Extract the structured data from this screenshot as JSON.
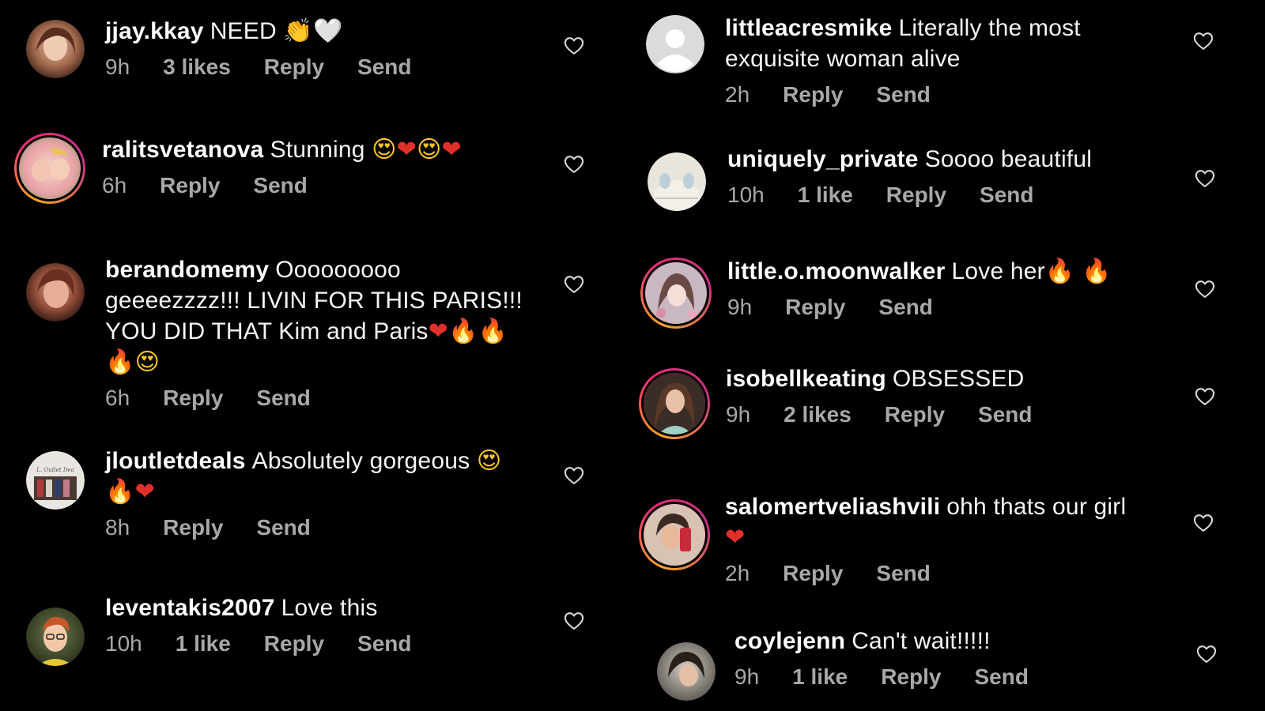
{
  "colors": {
    "background": "#000000",
    "text": "#ffffff",
    "meta": "#a8a8a8",
    "story_ring_start": "#f9a825",
    "story_ring_end": "#c13584"
  },
  "icons": {
    "like": "heart-outline-icon",
    "default_avatar": "default-avatar-icon"
  },
  "left_column": [
    {
      "username": "jjay.kkay",
      "text": "NEED",
      "emoji": [
        "👏",
        "🤍"
      ],
      "time": "9h",
      "likes": "3 likes",
      "reply": "Reply",
      "send": "Send"
    },
    {
      "username": "ralitsvetanova",
      "text": "Stunning",
      "emoji": [
        "😍",
        "❤",
        "😍",
        "❤"
      ],
      "time": "6h",
      "likes": "",
      "reply": "Reply",
      "send": "Send"
    },
    {
      "username": "berandomemy",
      "text_line1": "Ooooooooo",
      "text_line2": "geeeezzzz!!! LIVIN FOR THIS PARIS!!!",
      "text_line3": "YOU DID THAT Kim and Paris",
      "emoji_line3": [
        "❤",
        "🔥",
        "🔥"
      ],
      "emoji_line4": [
        "🔥",
        "😍"
      ],
      "time": "6h",
      "likes": "",
      "reply": "Reply",
      "send": "Send"
    },
    {
      "username": "jloutletdeals",
      "text": "Absolutely gorgeous",
      "emoji": [
        "😍"
      ],
      "emoji_line2": [
        "🔥",
        "❤"
      ],
      "time": "8h",
      "likes": "",
      "reply": "Reply",
      "send": "Send"
    },
    {
      "username": "leventakis2007",
      "text": "Love this",
      "time": "10h",
      "likes": "1 like",
      "reply": "Reply",
      "send": "Send"
    }
  ],
  "right_column": [
    {
      "username": "littleacresmike",
      "text_line1": "Literally the most",
      "text_line2": "exquisite woman alive",
      "time": "2h",
      "likes": "",
      "reply": "Reply",
      "send": "Send"
    },
    {
      "username": "uniquely_private",
      "text": "Soooo beautiful",
      "time": "10h",
      "likes": "1 like",
      "reply": "Reply",
      "send": "Send"
    },
    {
      "username": "little.o.moonwalker",
      "text": "Love her",
      "emoji": [
        "🔥",
        "🔥"
      ],
      "time": "9h",
      "likes": "",
      "reply": "Reply",
      "send": "Send"
    },
    {
      "username": "isobellkeating",
      "text": "OBSESSED",
      "time": "9h",
      "likes": "2 likes",
      "reply": "Reply",
      "send": "Send"
    },
    {
      "username": "salomertveliashvili",
      "text": "ohh thats our girl",
      "emoji_line2": [
        "❤"
      ],
      "time": "2h",
      "likes": "",
      "reply": "Reply",
      "send": "Send"
    },
    {
      "username": "coylejenn",
      "text": "Can't wait!!!!!",
      "time": "9h",
      "likes": "1 like",
      "reply": "Reply",
      "send": "Send"
    }
  ]
}
